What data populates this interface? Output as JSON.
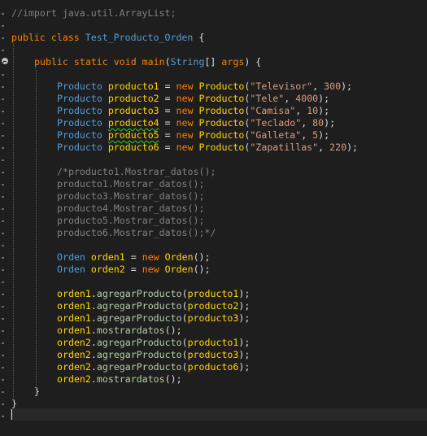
{
  "editor": {
    "lines": [
      {
        "ind": 0,
        "tokens": [
          {
            "t": "//import java.util.ArrayList;",
            "c": "cg"
          }
        ]
      },
      {
        "ind": 0,
        "tokens": []
      },
      {
        "ind": 0,
        "tokens": [
          {
            "t": "public",
            "c": "orange"
          },
          {
            "t": " ",
            "c": "pl"
          },
          {
            "t": "class",
            "c": "orange"
          },
          {
            "t": " ",
            "c": "pl"
          },
          {
            "t": "Test_Producto_Orden",
            "c": "kw"
          },
          {
            "t": " {",
            "c": "pl"
          }
        ]
      },
      {
        "ind": 0,
        "tokens": []
      },
      {
        "ind": 1,
        "tokens": [
          {
            "t": "public",
            "c": "orange"
          },
          {
            "t": " ",
            "c": "pl"
          },
          {
            "t": "static",
            "c": "orange"
          },
          {
            "t": " ",
            "c": "pl"
          },
          {
            "t": "void",
            "c": "orange"
          },
          {
            "t": " ",
            "c": "pl"
          },
          {
            "t": "main",
            "c": "orange"
          },
          {
            "t": "(",
            "c": "pl"
          },
          {
            "t": "String",
            "c": "kw"
          },
          {
            "t": "[] ",
            "c": "pl"
          },
          {
            "t": "args",
            "c": "orange"
          },
          {
            "t": ") {",
            "c": "pl"
          }
        ]
      },
      {
        "ind": 0,
        "tokens": []
      },
      {
        "ind": 2,
        "tokens": [
          {
            "t": "Producto",
            "c": "kw"
          },
          {
            "t": " ",
            "c": "pl"
          },
          {
            "t": "producto1",
            "c": "var"
          },
          {
            "t": " = ",
            "c": "pl"
          },
          {
            "t": "new",
            "c": "orange"
          },
          {
            "t": " ",
            "c": "pl"
          },
          {
            "t": "Producto",
            "c": "var"
          },
          {
            "t": "(",
            "c": "pl"
          },
          {
            "t": "\"Televisor\"",
            "c": "st"
          },
          {
            "t": ", ",
            "c": "pl"
          },
          {
            "t": "300",
            "c": "st"
          },
          {
            "t": ");",
            "c": "pl"
          }
        ]
      },
      {
        "ind": 2,
        "tokens": [
          {
            "t": "Producto",
            "c": "kw"
          },
          {
            "t": " ",
            "c": "pl"
          },
          {
            "t": "producto2",
            "c": "var"
          },
          {
            "t": " = ",
            "c": "pl"
          },
          {
            "t": "new",
            "c": "orange"
          },
          {
            "t": " ",
            "c": "pl"
          },
          {
            "t": "Producto",
            "c": "var"
          },
          {
            "t": "(",
            "c": "pl"
          },
          {
            "t": "\"Tele\"",
            "c": "st"
          },
          {
            "t": ", ",
            "c": "pl"
          },
          {
            "t": "4000",
            "c": "st"
          },
          {
            "t": ");",
            "c": "pl"
          }
        ]
      },
      {
        "ind": 2,
        "tokens": [
          {
            "t": "Producto",
            "c": "kw"
          },
          {
            "t": " ",
            "c": "pl"
          },
          {
            "t": "producto3",
            "c": "var"
          },
          {
            "t": " = ",
            "c": "pl"
          },
          {
            "t": "new",
            "c": "orange"
          },
          {
            "t": " ",
            "c": "pl"
          },
          {
            "t": "Producto",
            "c": "var"
          },
          {
            "t": "(",
            "c": "pl"
          },
          {
            "t": "\"Camisa\"",
            "c": "st"
          },
          {
            "t": ", ",
            "c": "pl"
          },
          {
            "t": "10",
            "c": "st"
          },
          {
            "t": ");",
            "c": "pl"
          }
        ]
      },
      {
        "ind": 2,
        "tokens": [
          {
            "t": "Producto",
            "c": "kw"
          },
          {
            "t": " ",
            "c": "pl"
          },
          {
            "t": "producto4",
            "c": "var",
            "sq": true
          },
          {
            "t": " = ",
            "c": "pl"
          },
          {
            "t": "new",
            "c": "orange"
          },
          {
            "t": " ",
            "c": "pl"
          },
          {
            "t": "Producto",
            "c": "var"
          },
          {
            "t": "(",
            "c": "pl"
          },
          {
            "t": "\"Teclado\"",
            "c": "st"
          },
          {
            "t": ", ",
            "c": "pl"
          },
          {
            "t": "80",
            "c": "st"
          },
          {
            "t": ");",
            "c": "pl"
          }
        ]
      },
      {
        "ind": 2,
        "tokens": [
          {
            "t": "Producto",
            "c": "kw"
          },
          {
            "t": " ",
            "c": "pl"
          },
          {
            "t": "producto5",
            "c": "var",
            "sq": true
          },
          {
            "t": " = ",
            "c": "pl"
          },
          {
            "t": "new",
            "c": "orange"
          },
          {
            "t": " ",
            "c": "pl"
          },
          {
            "t": "Producto",
            "c": "var"
          },
          {
            "t": "(",
            "c": "pl"
          },
          {
            "t": "\"Galleta\"",
            "c": "st"
          },
          {
            "t": ", ",
            "c": "pl"
          },
          {
            "t": "5",
            "c": "st"
          },
          {
            "t": ");",
            "c": "pl"
          }
        ]
      },
      {
        "ind": 2,
        "tokens": [
          {
            "t": "Producto",
            "c": "kw"
          },
          {
            "t": " ",
            "c": "pl"
          },
          {
            "t": "producto6",
            "c": "var"
          },
          {
            "t": " = ",
            "c": "pl"
          },
          {
            "t": "new",
            "c": "orange"
          },
          {
            "t": " ",
            "c": "pl"
          },
          {
            "t": "Producto",
            "c": "var"
          },
          {
            "t": "(",
            "c": "pl"
          },
          {
            "t": "\"Zapatillas\"",
            "c": "st"
          },
          {
            "t": ", ",
            "c": "pl"
          },
          {
            "t": "220",
            "c": "st"
          },
          {
            "t": ");",
            "c": "pl"
          }
        ]
      },
      {
        "ind": 0,
        "tokens": []
      },
      {
        "ind": 2,
        "tokens": [
          {
            "t": "/*producto1.Mostrar_datos();",
            "c": "cg"
          }
        ]
      },
      {
        "ind": 2,
        "tokens": [
          {
            "t": "producto1.Mostrar_datos();",
            "c": "cg"
          }
        ]
      },
      {
        "ind": 2,
        "tokens": [
          {
            "t": "producto3.Mostrar_datos();",
            "c": "cg"
          }
        ]
      },
      {
        "ind": 2,
        "tokens": [
          {
            "t": "producto4.Mostrar_datos();",
            "c": "cg"
          }
        ]
      },
      {
        "ind": 2,
        "tokens": [
          {
            "t": "producto5.Mostrar_datos();",
            "c": "cg"
          }
        ]
      },
      {
        "ind": 2,
        "tokens": [
          {
            "t": "producto6.Mostrar_datos();*/",
            "c": "cg"
          }
        ]
      },
      {
        "ind": 0,
        "tokens": []
      },
      {
        "ind": 2,
        "tokens": [
          {
            "t": "Orden",
            "c": "kw"
          },
          {
            "t": " ",
            "c": "pl"
          },
          {
            "t": "orden1",
            "c": "var"
          },
          {
            "t": " = ",
            "c": "pl"
          },
          {
            "t": "new",
            "c": "orange"
          },
          {
            "t": " ",
            "c": "pl"
          },
          {
            "t": "Orden",
            "c": "var"
          },
          {
            "t": "();",
            "c": "pl"
          }
        ]
      },
      {
        "ind": 2,
        "tokens": [
          {
            "t": "Orden",
            "c": "kw"
          },
          {
            "t": " ",
            "c": "pl"
          },
          {
            "t": "orden2",
            "c": "var"
          },
          {
            "t": " = ",
            "c": "pl"
          },
          {
            "t": "new",
            "c": "orange"
          },
          {
            "t": " ",
            "c": "pl"
          },
          {
            "t": "Orden",
            "c": "var"
          },
          {
            "t": "();",
            "c": "pl"
          }
        ]
      },
      {
        "ind": 0,
        "tokens": []
      },
      {
        "ind": 2,
        "tokens": [
          {
            "t": "orden1",
            "c": "var"
          },
          {
            "t": ".",
            "c": "pl"
          },
          {
            "t": "agregarProducto",
            "c": "nm"
          },
          {
            "t": "(",
            "c": "pl"
          },
          {
            "t": "producto1",
            "c": "var"
          },
          {
            "t": ");",
            "c": "pl"
          }
        ]
      },
      {
        "ind": 2,
        "tokens": [
          {
            "t": "orden1",
            "c": "var"
          },
          {
            "t": ".",
            "c": "pl"
          },
          {
            "t": "agregarProducto",
            "c": "nm"
          },
          {
            "t": "(",
            "c": "pl"
          },
          {
            "t": "producto2",
            "c": "var"
          },
          {
            "t": ");",
            "c": "pl"
          }
        ]
      },
      {
        "ind": 2,
        "tokens": [
          {
            "t": "orden1",
            "c": "var"
          },
          {
            "t": ".",
            "c": "pl"
          },
          {
            "t": "agregarProducto",
            "c": "nm"
          },
          {
            "t": "(",
            "c": "pl"
          },
          {
            "t": "producto3",
            "c": "var"
          },
          {
            "t": ");",
            "c": "pl"
          }
        ]
      },
      {
        "ind": 2,
        "tokens": [
          {
            "t": "orden1",
            "c": "var"
          },
          {
            "t": ".",
            "c": "pl"
          },
          {
            "t": "mostrardatos",
            "c": "nm"
          },
          {
            "t": "();",
            "c": "pl"
          }
        ]
      },
      {
        "ind": 2,
        "tokens": [
          {
            "t": "orden2",
            "c": "var"
          },
          {
            "t": ".",
            "c": "pl"
          },
          {
            "t": "agregarProducto",
            "c": "nm"
          },
          {
            "t": "(",
            "c": "pl"
          },
          {
            "t": "producto1",
            "c": "var"
          },
          {
            "t": ");",
            "c": "pl"
          }
        ]
      },
      {
        "ind": 2,
        "tokens": [
          {
            "t": "orden2",
            "c": "var"
          },
          {
            "t": ".",
            "c": "pl"
          },
          {
            "t": "agregarProducto",
            "c": "nm"
          },
          {
            "t": "(",
            "c": "pl"
          },
          {
            "t": "producto3",
            "c": "var"
          },
          {
            "t": ");",
            "c": "pl"
          }
        ]
      },
      {
        "ind": 2,
        "tokens": [
          {
            "t": "orden2",
            "c": "var"
          },
          {
            "t": ".",
            "c": "pl"
          },
          {
            "t": "agregarProducto",
            "c": "nm"
          },
          {
            "t": "(",
            "c": "pl"
          },
          {
            "t": "producto6",
            "c": "var"
          },
          {
            "t": ");",
            "c": "pl"
          }
        ]
      },
      {
        "ind": 2,
        "tokens": [
          {
            "t": "orden2",
            "c": "var"
          },
          {
            "t": ".",
            "c": "pl"
          },
          {
            "t": "mostrardatos",
            "c": "nm"
          },
          {
            "t": "();",
            "c": "pl"
          }
        ]
      },
      {
        "ind": 1,
        "tokens": [
          {
            "t": "}",
            "c": "pl"
          }
        ]
      },
      {
        "ind": 0,
        "tokens": [
          {
            "t": "}",
            "c": "pl"
          }
        ]
      }
    ]
  },
  "colors": {
    "background": "#1e1e1e",
    "keyword_orange": "#ff8000",
    "type_blue": "#569cd6",
    "identifier_yellow": "#ffd700",
    "string_salmon": "#d69d85",
    "method_green": "#b5cea8",
    "comment_gray": "#808080"
  }
}
